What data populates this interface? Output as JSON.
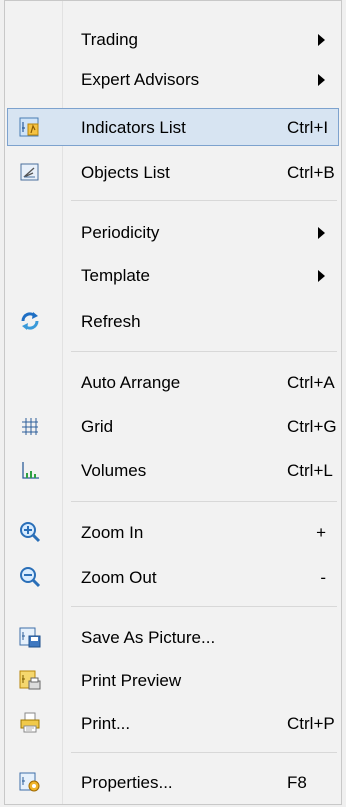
{
  "menu": {
    "items": [
      {
        "label": "Trading",
        "shortcut": "",
        "submenu": true,
        "icon": ""
      },
      {
        "label": "Expert Advisors",
        "shortcut": "",
        "submenu": true,
        "icon": ""
      },
      {
        "label": "Indicators List",
        "shortcut": "Ctrl+I",
        "submenu": false,
        "icon": "indicators-list-icon",
        "highlighted": true
      },
      {
        "label": "Objects List",
        "shortcut": "Ctrl+B",
        "submenu": false,
        "icon": "objects-list-icon"
      },
      {
        "label": "Periodicity",
        "shortcut": "",
        "submenu": true,
        "icon": ""
      },
      {
        "label": "Template",
        "shortcut": "",
        "submenu": true,
        "icon": ""
      },
      {
        "label": "Refresh",
        "shortcut": "",
        "submenu": false,
        "icon": "refresh-icon"
      },
      {
        "label": "Auto Arrange",
        "shortcut": "Ctrl+A",
        "submenu": false,
        "icon": ""
      },
      {
        "label": "Grid",
        "shortcut": "Ctrl+G",
        "submenu": false,
        "icon": "grid-icon"
      },
      {
        "label": "Volumes",
        "shortcut": "Ctrl+L",
        "submenu": false,
        "icon": "volumes-icon"
      },
      {
        "label": "Zoom In",
        "shortcut": "+",
        "submenu": false,
        "icon": "zoom-in-icon"
      },
      {
        "label": "Zoom Out",
        "shortcut": "-",
        "submenu": false,
        "icon": "zoom-out-icon"
      },
      {
        "label": "Save As Picture...",
        "shortcut": "",
        "submenu": false,
        "icon": "save-picture-icon"
      },
      {
        "label": "Print Preview",
        "shortcut": "",
        "submenu": false,
        "icon": "print-preview-icon"
      },
      {
        "label": "Print...",
        "shortcut": "Ctrl+P",
        "submenu": false,
        "icon": "printer-icon"
      },
      {
        "label": "Properties...",
        "shortcut": "F8",
        "submenu": false,
        "icon": "properties-icon"
      }
    ]
  },
  "colors": {
    "highlight_bg": "#d7e4f2",
    "highlight_border": "#7da2ce",
    "menu_bg": "#f2f2f2"
  }
}
